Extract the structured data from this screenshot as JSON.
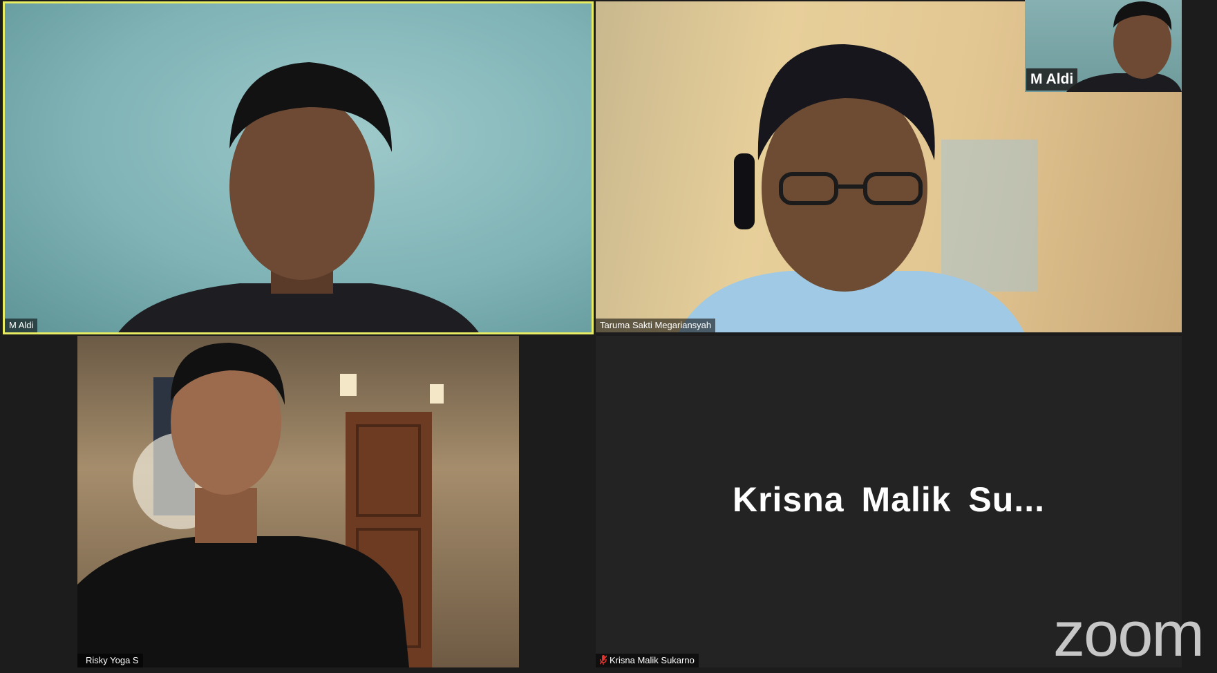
{
  "participants": [
    {
      "name": "M Aldi",
      "active_speaker": true
    },
    {
      "name": "Taruma Sakti Megariansyah"
    },
    {
      "name": "Risky Yoga S"
    },
    {
      "name": "Krisna Malik Sukarno",
      "muted": true,
      "video_off_display_name": "Krisna  Malik  Su..."
    }
  ],
  "self_view": {
    "name": "M Aldi"
  },
  "watermark": "zoom",
  "colors": {
    "active_speaker_border": "#e8ec63",
    "muted_icon": "#e0342f",
    "background": "#1c1c1c"
  }
}
